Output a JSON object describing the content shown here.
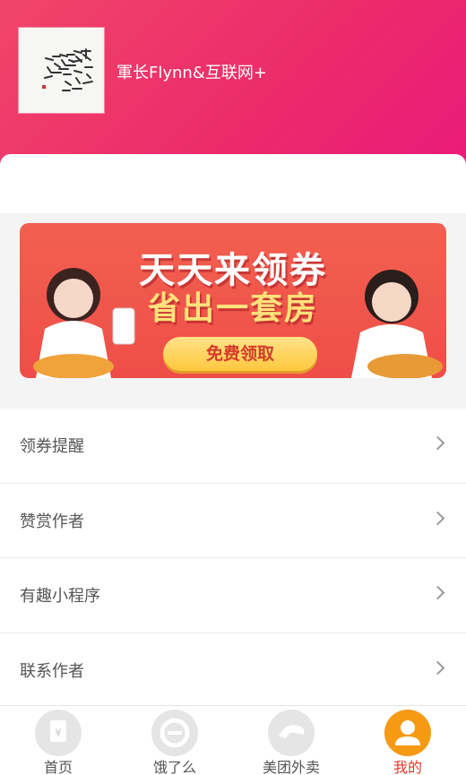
{
  "profile": {
    "name": "軍长Flynn&互联网+",
    "avatar_icon": "calligraphy-avatar-icon"
  },
  "banner": {
    "title": "天天来领券",
    "subtitle": "省出一套房",
    "button": "免费领取"
  },
  "menu": [
    {
      "label": "领券提醒"
    },
    {
      "label": "赞赏作者"
    },
    {
      "label": "有趣小程序"
    },
    {
      "label": "联系作者"
    }
  ],
  "tabbar": [
    {
      "label": "首页",
      "icon": "coupon-icon"
    },
    {
      "label": "饿了么",
      "icon": "eleme-icon"
    },
    {
      "label": "美团外卖",
      "icon": "meituan-icon"
    },
    {
      "label": "我的",
      "icon": "user-icon",
      "active": true
    }
  ],
  "colors": {
    "header_start": "#f0456a",
    "header_end": "#e9177d",
    "active_tab_icon": "#f59a12",
    "active_tab_label": "#e8362b"
  }
}
